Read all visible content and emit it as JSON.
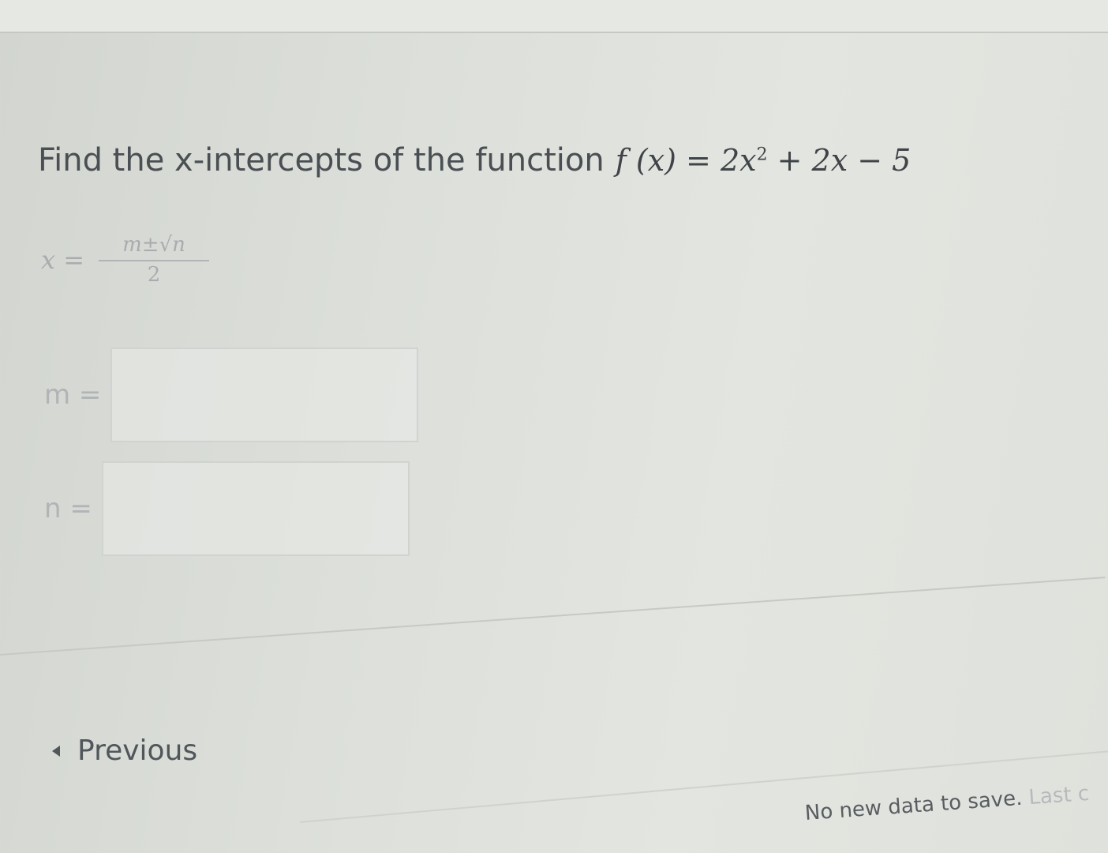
{
  "question": {
    "prefix": "Find the x-intercepts of the function",
    "function_expr": "f (x) = 2x",
    "exponent": "2",
    "function_rest": " + 2x − 5"
  },
  "formula": {
    "lhs": "x =",
    "numerator": "m±√n",
    "denominator": "2"
  },
  "fields": {
    "m_label": "m =",
    "m_value": "",
    "n_label": "n =",
    "n_value": ""
  },
  "nav": {
    "previous_label": "Previous"
  },
  "status": {
    "text": "No new data to save.",
    "tail": "Last c"
  }
}
